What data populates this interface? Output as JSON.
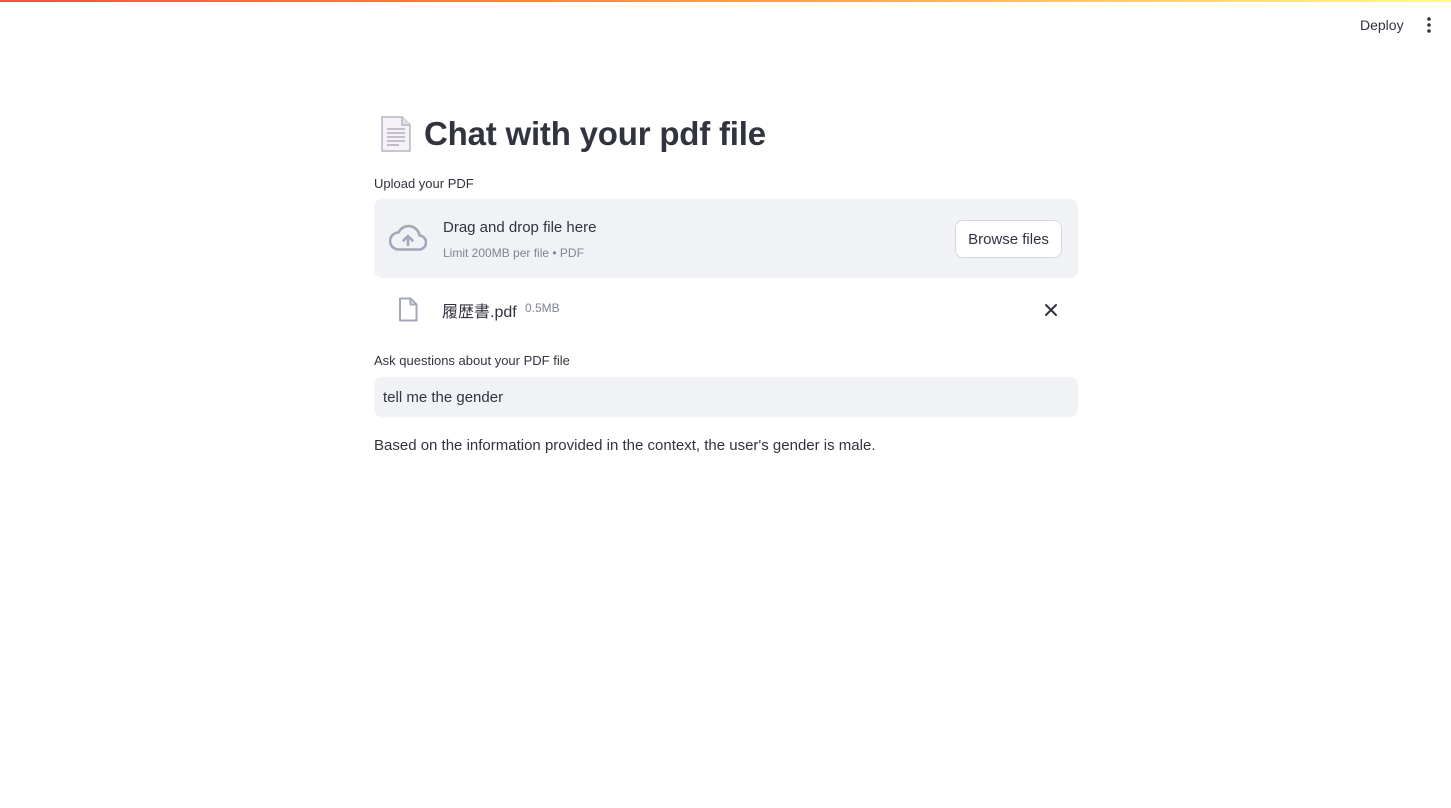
{
  "header": {
    "deploy_label": "Deploy",
    "menu_icon": "vertical-dots-icon"
  },
  "page": {
    "title": "Chat with your pdf file",
    "title_icon": "page-facing-up-emoji"
  },
  "uploader": {
    "label": "Upload your PDF",
    "drop_title": "Drag and drop file here",
    "drop_limit": "Limit 200MB per file • PDF",
    "browse_label": "Browse files",
    "icon": "cloud-upload-icon"
  },
  "uploaded_file": {
    "name": "履歴書.pdf",
    "size": "0.5MB",
    "icon": "file-icon",
    "remove_icon": "close-icon"
  },
  "question": {
    "label": "Ask questions about your PDF file",
    "value": "tell me the gender"
  },
  "answer": {
    "text": "Based on the information provided in the context, the user's gender is male."
  },
  "colors": {
    "accent_gradient_start": "#ff4b4b",
    "accent_gradient_end": "#fffd80",
    "panel_bg": "#f0f2f6",
    "text": "#31333f",
    "muted_text": "#808495",
    "icon_gray": "#a3a8b8"
  }
}
